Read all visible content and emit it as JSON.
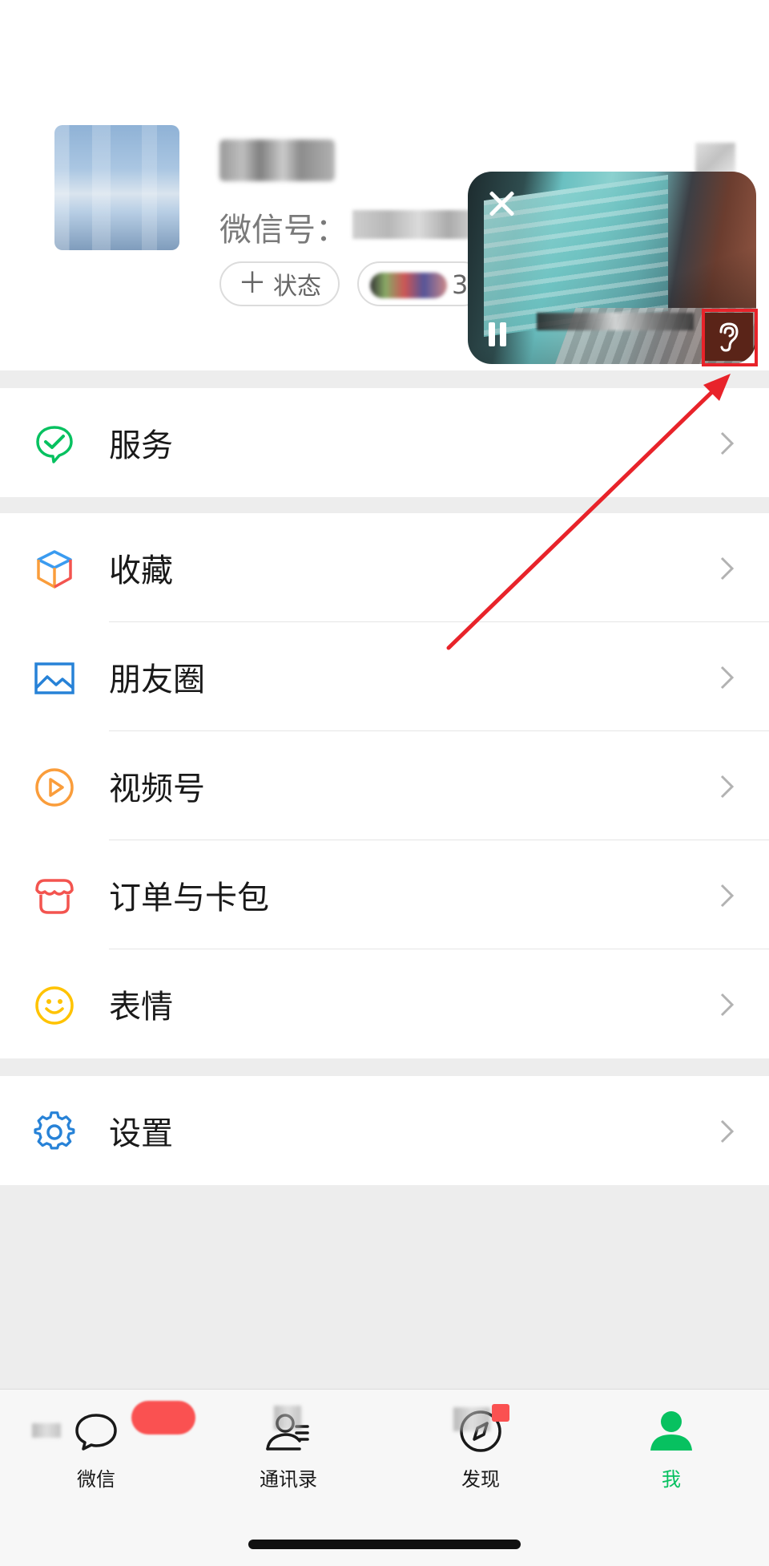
{
  "profile": {
    "wxid_label": "微信号：",
    "wxid_value_partial": "",
    "status_label": "状态",
    "friends_count": "3"
  },
  "menu": {
    "services": "服务",
    "favorites": "收藏",
    "moments": "朋友圈",
    "channels": "视频号",
    "orders": "订单与卡包",
    "stickers": "表情",
    "settings": "设置"
  },
  "tabs": {
    "chats": "微信",
    "contacts": "通讯录",
    "discover": "发现",
    "me": "我"
  },
  "colors": {
    "accent_green": "#07c160",
    "annotation_red": "#e8232a",
    "badge_red": "#fa5151"
  },
  "icons": {
    "services": "services-check-icon",
    "favorites": "cube-icon",
    "moments": "picture-icon",
    "channels": "play-icon",
    "orders": "wallet-icon",
    "stickers": "smiley-icon",
    "settings": "gear-icon",
    "floating_close": "close-icon",
    "floating_pause": "pause-icon",
    "floating_ear": "ear-icon"
  }
}
